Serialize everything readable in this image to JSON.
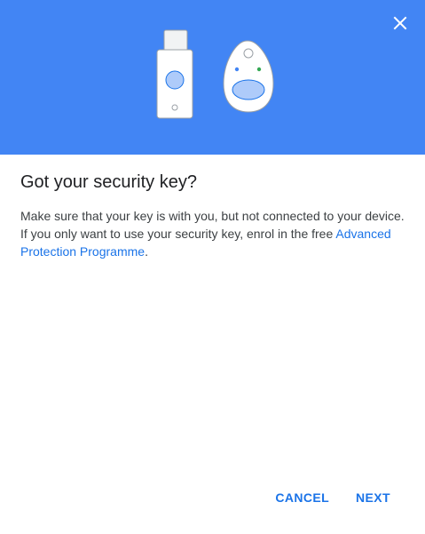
{
  "dialog": {
    "title": "Got your security key?",
    "body_line_1": "Make sure that your key is with you, but not connected to your device.",
    "body_line_2_prefix": "If you only want to use your security key, enrol in the free ",
    "body_link": "Advanced Protection Programme",
    "body_line_2_suffix": ".",
    "cancel_label": "CANCEL",
    "next_label": "NEXT"
  },
  "colors": {
    "header_bg": "#4285f4",
    "link": "#1a73e8",
    "button_text": "#1a73e8",
    "title_text": "#202124",
    "body_text": "#3c4043"
  },
  "icons": {
    "close": "close-icon",
    "illustration": "security-keys-illustration"
  }
}
